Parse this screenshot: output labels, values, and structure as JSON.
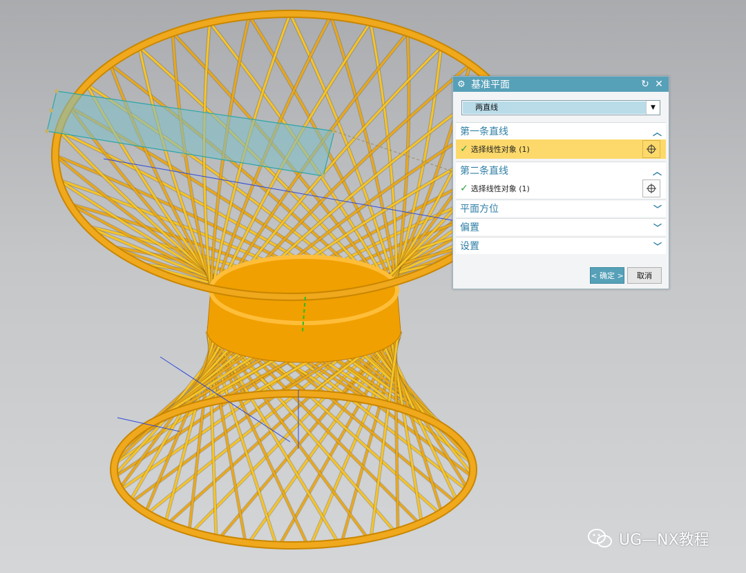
{
  "dialog": {
    "title": "基准平面",
    "type_value": "两直线",
    "first_line": {
      "header": "第一条直线",
      "select_label": "选择线性对象 (1)"
    },
    "second_line": {
      "header": "第二条直线",
      "select_label": "选择线性对象 (1)"
    },
    "collapsed_sections": [
      "平面方位",
      "偏置",
      "设置"
    ],
    "ok_label": "< 确定 >",
    "cancel_label": "取消"
  },
  "watermark": {
    "text": "UG—NX教程",
    "icon": "wechat-icon"
  },
  "colors": {
    "model_rods": "#f0a81c",
    "dialog_titlebar": "#56a0b8",
    "active_row": "#fcd96a",
    "plane_fill": "#7cc0c8",
    "section_header": "#2f7fa6"
  }
}
